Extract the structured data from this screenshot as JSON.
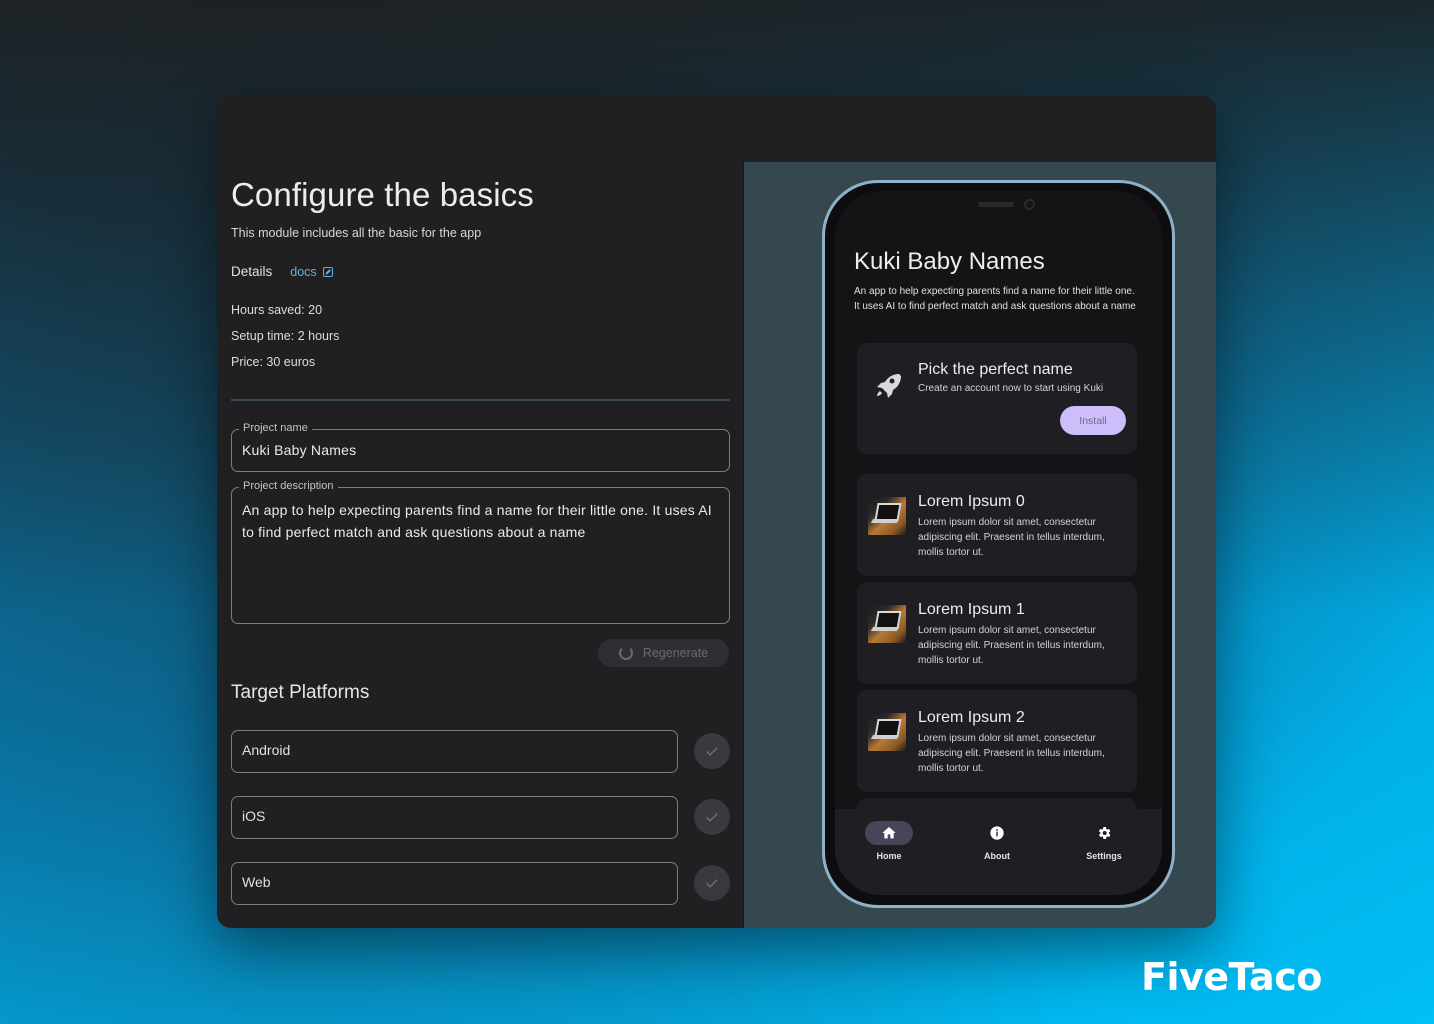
{
  "brand": "FiveTaco",
  "config": {
    "title": "Configure the basics",
    "subtitle": "This module includes all the basic for the app",
    "details_label": "Details",
    "docs_link": "docs",
    "stats": {
      "hours_saved": "Hours saved: 20",
      "setup_time": "Setup time: 2 hours",
      "price": "Price: 30 euros"
    },
    "project_name": {
      "label": "Project name",
      "value": "Kuki Baby Names"
    },
    "project_description": {
      "label": "Project description",
      "value": "An app to help expecting parents find a name for their little one. It uses AI to find perfect match and ask questions about a name"
    },
    "regenerate_label": "Regenerate",
    "platforms_title": "Target Platforms",
    "platforms": [
      {
        "name": "Android"
      },
      {
        "name": "iOS"
      },
      {
        "name": "Web"
      }
    ]
  },
  "preview": {
    "app_title": "Kuki Baby Names",
    "app_description": "An app to help expecting parents find a name for their little one. It uses AI to find perfect match and ask questions about a name",
    "hero": {
      "title": "Pick the perfect name",
      "subtitle": "Create an account now to start using Kuki",
      "button": "Install"
    },
    "items": [
      {
        "title": "Lorem Ipsum 0",
        "body": "Lorem ipsum dolor sit amet, consectetur adipiscing elit. Praesent in tellus interdum, mollis tortor ut."
      },
      {
        "title": "Lorem Ipsum 1",
        "body": "Lorem ipsum dolor sit amet, consectetur adipiscing elit. Praesent in tellus interdum, mollis tortor ut."
      },
      {
        "title": "Lorem Ipsum 2",
        "body": "Lorem ipsum dolor sit amet, consectetur adipiscing elit. Praesent in tellus interdum, mollis tortor ut."
      }
    ],
    "nav": [
      {
        "label": "Home",
        "icon": "home-icon",
        "active": true
      },
      {
        "label": "About",
        "icon": "info-icon",
        "active": false
      },
      {
        "label": "Settings",
        "icon": "gear-icon",
        "active": false
      }
    ],
    "accent": "#cdbdfb"
  }
}
